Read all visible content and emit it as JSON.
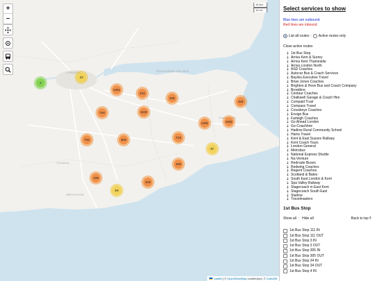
{
  "map": {
    "zoom_in": "+",
    "zoom_out": "−",
    "fullscreen_icon": "fullscreen-icon",
    "bus_icon": "bus-icon",
    "search_icon": "search-icon",
    "scale": {
      "km": "10 km",
      "mi": "10 mi"
    },
    "places": {
      "london": "LONDON",
      "southend": "SOUTHEND-ON-SEA",
      "canterbury": "Canterbury",
      "brighton": "BRIGHTON",
      "crawley": "Crawley"
    },
    "clusters": [
      {
        "label": "2",
        "color": "green"
      },
      {
        "label": "40",
        "color": "yellow"
      },
      {
        "label": "1361",
        "color": "orange"
      },
      {
        "label": "315",
        "color": "orange"
      },
      {
        "label": "405",
        "color": "orange"
      },
      {
        "label": "430",
        "color": "orange"
      },
      {
        "label": "794",
        "color": "orange"
      },
      {
        "label": "1840",
        "color": "orange"
      },
      {
        "label": "1305",
        "color": "orange"
      },
      {
        "label": "1063",
        "color": "orange"
      },
      {
        "label": "794",
        "color": "orange"
      },
      {
        "label": "960",
        "color": "orange"
      },
      {
        "label": "719",
        "color": "orange"
      },
      {
        "label": "87",
        "color": "yellow"
      },
      {
        "label": "269",
        "color": "orange"
      },
      {
        "label": "199",
        "color": "orange"
      },
      {
        "label": "229",
        "color": "orange"
      },
      {
        "label": "69",
        "color": "yellow"
      }
    ],
    "attribution": {
      "leaflet": "Leaflet",
      "sep": "|",
      "osm": "OpenStreetMap",
      "contrib": "contributors,",
      "carto": "CartoDB"
    },
    "colors": {
      "cluster_orange": "#f0873c",
      "cluster_yellow": "#f1d357",
      "cluster_green": "#82d250",
      "water": "#cfe3ee"
    }
  },
  "panel": {
    "title": "Select services to show",
    "outbound_note": "Blue lines are outbound",
    "inbound_note": "Red lines are inbound",
    "radio_all": "List all routes",
    "radio_sep": ":",
    "radio_active": "Active routes only",
    "close_link": "Close active routes",
    "operators": [
      "1st Bus Stop",
      "Arriva Kent & Surrey",
      "Arriva Kent Thameside",
      "Arriva London North",
      "ASD Coaches",
      "Autocar Bus & Coach Services",
      "Bayliss Executive Travel",
      "Brian Jones Coaches",
      "Brighton & Hove Bus and Coach Company",
      "Brookline",
      "Centaur Coaches",
      "Chalkwell Garage & Coach Hire",
      "Compaid Trust",
      "Compass Travel",
      "Crosskeys Coaches",
      "Ensign Bus",
      "Farleigh Coaches",
      "Go Ahead London",
      "Go-Coachhire",
      "Hadlow Rural Community School",
      "Hams Travel",
      "Kent & East Sussex Railway",
      "Kent Coach Tours",
      "London General",
      "Metrobus",
      "National Express Shuttle",
      "Nu-Venture",
      "Redroute Buses",
      "Redwing Coaches",
      "Regent Coaches",
      "Scotland & Bates",
      "South East London & Kent",
      "Spa Valley Railway",
      "Stagecoach in East Kent",
      "Stagecoach South East",
      "Starline",
      "Travelmasters"
    ],
    "section_title": "1st Bus Stop",
    "show_all": "Show all",
    "show_sep": ":",
    "hide_all": "Hide all",
    "back_to_top": "Back to top",
    "stops": [
      "1st Bus Stop 111 IN",
      "1st Bus Stop 111 OUT",
      "1st Bus Stop 3 IN",
      "1st Bus Stop 3 OUT",
      "1st Bus Stop 305 IN",
      "1st Bus Stop 305 OUT",
      "1st Bus Stop 34 IN",
      "1st Bus Stop 34 OUT",
      "1st Bus Stop 4 IN"
    ],
    "colors": {
      "outbound": "#1a2ad6",
      "inbound": "#d41818"
    }
  }
}
